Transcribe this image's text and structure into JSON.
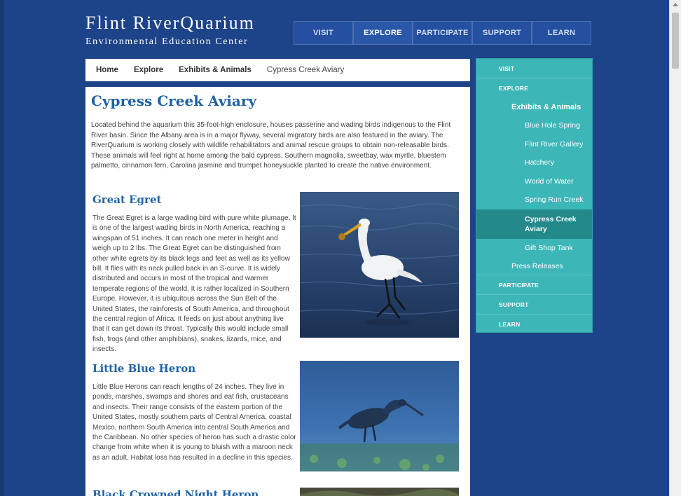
{
  "logo": {
    "line1": "Flint RiverQuarium",
    "line2": "Environmental Education Center"
  },
  "topnav": [
    {
      "label": "VISIT"
    },
    {
      "label": "EXPLORE"
    },
    {
      "label": "PARTICIPATE"
    },
    {
      "label": "SUPPORT"
    },
    {
      "label": "LEARN"
    }
  ],
  "breadcrumb": [
    "Home",
    "Explore",
    "Exhibits & Animals",
    "Cypress Creek Aviary"
  ],
  "page": {
    "title": "Cypress Creek Aviary",
    "intro": "Located behind the aquarium this 35-foot-high enclosure, houses passerine and wading birds indigenous to the Flint River basin. Since the Albany area is in a major flyway, several migratory birds are also featured in the aviary. The RiverQuarium is working closely with wildlife rehabilitators and animal rescue groups to obtain non-releasable birds. These animals will feel right at home among the bald cypress, Southern magnolia, sweetbay, wax myrtle, bluestem palmetto, cinnamon fern, Carolina jasmine and trumpet honeysuckle planted to create the native environment."
  },
  "animals": [
    {
      "title": "Great Egret",
      "text": "The Great Egret is a large wading bird with pure white plumage. It is one of the largest wading birds in North America, reaching a wingspan of 51 inches. It can reach one meter in height and weigh up to 2 lbs. The Great Egret can be distinguished from other white egrets by its black legs and feet as well as its yellow bill. It flies with its neck pulled back in an S-curve.  It is widely distributed and occurs in most of the tropical and warmer temperate regions of the world. It is rather localized in Southern Europe. However, it is ubiquitous across the Sun Belt of the United States, the rainforests of South America, and throughout the central region of Africa.  It feeds on just about anything live that it can get down its throat. Typically this would include small fish, frogs (and other amphibians), snakes, lizards, mice, and insects."
    },
    {
      "title": "Little Blue Heron",
      "text": "Little Blue Herons can reach lengths of 24 inches. They live in ponds, marshes, swamps and shores and eat fish, crustaceans and insects. Their range consists of the eastern portion of the United States, mostly southern parts of Central America, coastal Mexico, northern South America into central South America and the Caribbean.  No other species of heron has such a drastic color change from white when it is young to bluish with a maroon neck as an adult. Habitat loss has resulted in a decline in this species."
    },
    {
      "title": "Black Crowned Night Heron"
    }
  ],
  "sidebar": {
    "items": [
      {
        "label": "VISIT"
      },
      {
        "label": "EXPLORE"
      },
      {
        "label": "Exhibits & Animals"
      },
      {
        "label": "Blue Hole Spring"
      },
      {
        "label": "Flint River Gallery"
      },
      {
        "label": "Hatchery"
      },
      {
        "label": "World of Water"
      },
      {
        "label": "Spring Run Creek"
      },
      {
        "label": "Cypress Creek Aviary"
      },
      {
        "label": "Gift Shop Tank"
      },
      {
        "label": "Press Releases"
      },
      {
        "label": "PARTICIPATE"
      },
      {
        "label": "SUPPORT"
      },
      {
        "label": "LEARN"
      }
    ]
  },
  "colors": {
    "background": "#1d4388",
    "accent_teal": "#3db6b8",
    "active_teal": "#24898b",
    "title_blue": "#1e63a6"
  }
}
